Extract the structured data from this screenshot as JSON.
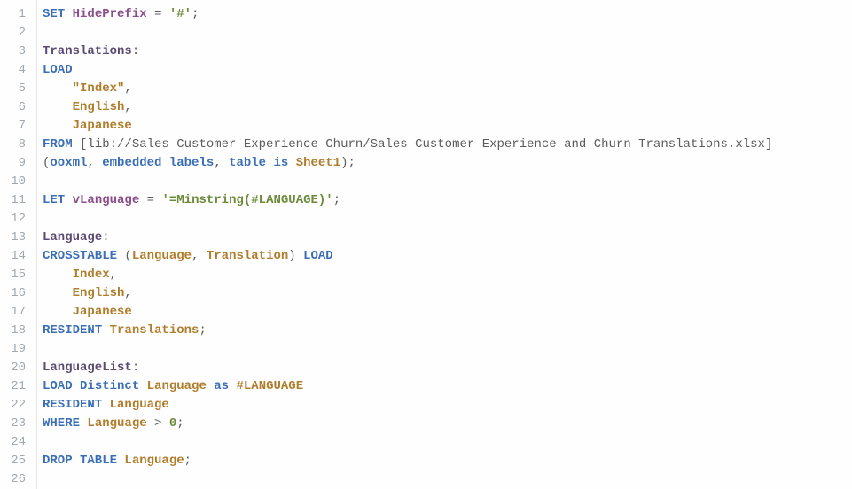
{
  "editor": {
    "lines": [
      {
        "tokens": [
          {
            "t": "SET",
            "c": "tok-set"
          },
          {
            "t": " ",
            "c": ""
          },
          {
            "t": "HidePrefix",
            "c": "tok-var"
          },
          {
            "t": " ",
            "c": ""
          },
          {
            "t": "=",
            "c": "tok-op"
          },
          {
            "t": " ",
            "c": ""
          },
          {
            "t": "'#'",
            "c": "tok-str"
          },
          {
            "t": ";",
            "c": "tok-punc"
          }
        ]
      },
      {
        "tokens": []
      },
      {
        "tokens": [
          {
            "t": "Translations",
            "c": "tok-label"
          },
          {
            "t": ":",
            "c": "tok-punc"
          }
        ]
      },
      {
        "tokens": [
          {
            "t": "LOAD",
            "c": "tok-kw"
          }
        ]
      },
      {
        "tokens": [
          {
            "t": "    ",
            "c": ""
          },
          {
            "t": "\"Index\"",
            "c": "tok-id"
          },
          {
            "t": ",",
            "c": "tok-punc"
          }
        ]
      },
      {
        "tokens": [
          {
            "t": "    ",
            "c": ""
          },
          {
            "t": "English",
            "c": "tok-id"
          },
          {
            "t": ",",
            "c": "tok-punc"
          }
        ]
      },
      {
        "tokens": [
          {
            "t": "    ",
            "c": ""
          },
          {
            "t": "Japanese",
            "c": "tok-id"
          }
        ]
      },
      {
        "tokens": [
          {
            "t": "FROM",
            "c": "tok-kw"
          },
          {
            "t": " ",
            "c": ""
          },
          {
            "t": "[lib://Sales Customer Experience Churn/Sales Customer Experience and Churn Translations.xlsx]",
            "c": "tok-path"
          }
        ]
      },
      {
        "tokens": [
          {
            "t": "(",
            "c": "tok-punc"
          },
          {
            "t": "ooxml",
            "c": "tok-kw"
          },
          {
            "t": ", ",
            "c": "tok-punc"
          },
          {
            "t": "embedded labels",
            "c": "tok-kw"
          },
          {
            "t": ", ",
            "c": "tok-punc"
          },
          {
            "t": "table is",
            "c": "tok-kw"
          },
          {
            "t": " ",
            "c": ""
          },
          {
            "t": "Sheet1",
            "c": "tok-id"
          },
          {
            "t": ");",
            "c": "tok-punc"
          }
        ]
      },
      {
        "tokens": []
      },
      {
        "tokens": [
          {
            "t": "LET",
            "c": "tok-set"
          },
          {
            "t": " ",
            "c": ""
          },
          {
            "t": "vLanguage",
            "c": "tok-var"
          },
          {
            "t": " ",
            "c": ""
          },
          {
            "t": "=",
            "c": "tok-op"
          },
          {
            "t": " ",
            "c": ""
          },
          {
            "t": "'=Minstring(#LANGUAGE)'",
            "c": "tok-str"
          },
          {
            "t": ";",
            "c": "tok-punc"
          }
        ]
      },
      {
        "tokens": []
      },
      {
        "tokens": [
          {
            "t": "Language",
            "c": "tok-label"
          },
          {
            "t": ":",
            "c": "tok-punc"
          }
        ]
      },
      {
        "tokens": [
          {
            "t": "CROSSTABLE",
            "c": "tok-kw"
          },
          {
            "t": " (",
            "c": "tok-punc"
          },
          {
            "t": "Language",
            "c": "tok-id"
          },
          {
            "t": ", ",
            "c": "tok-punc"
          },
          {
            "t": "Translation",
            "c": "tok-id"
          },
          {
            "t": ") ",
            "c": "tok-punc"
          },
          {
            "t": "LOAD",
            "c": "tok-kw"
          }
        ]
      },
      {
        "tokens": [
          {
            "t": "    ",
            "c": ""
          },
          {
            "t": "Index",
            "c": "tok-id"
          },
          {
            "t": ",",
            "c": "tok-punc"
          }
        ]
      },
      {
        "tokens": [
          {
            "t": "    ",
            "c": ""
          },
          {
            "t": "English",
            "c": "tok-id"
          },
          {
            "t": ",",
            "c": "tok-punc"
          }
        ]
      },
      {
        "tokens": [
          {
            "t": "    ",
            "c": ""
          },
          {
            "t": "Japanese",
            "c": "tok-id"
          }
        ]
      },
      {
        "tokens": [
          {
            "t": "RESIDENT",
            "c": "tok-kw"
          },
          {
            "t": " ",
            "c": ""
          },
          {
            "t": "Translations",
            "c": "tok-id"
          },
          {
            "t": ";",
            "c": "tok-punc"
          }
        ]
      },
      {
        "tokens": []
      },
      {
        "tokens": [
          {
            "t": "LanguageList",
            "c": "tok-label"
          },
          {
            "t": ":",
            "c": "tok-punc"
          }
        ]
      },
      {
        "tokens": [
          {
            "t": "LOAD",
            "c": "tok-kw"
          },
          {
            "t": " ",
            "c": ""
          },
          {
            "t": "Distinct",
            "c": "tok-kw"
          },
          {
            "t": " ",
            "c": ""
          },
          {
            "t": "Language",
            "c": "tok-id"
          },
          {
            "t": " ",
            "c": ""
          },
          {
            "t": "as",
            "c": "tok-kw"
          },
          {
            "t": " ",
            "c": ""
          },
          {
            "t": "#LANGUAGE",
            "c": "tok-id"
          }
        ]
      },
      {
        "tokens": [
          {
            "t": "RESIDENT",
            "c": "tok-kw"
          },
          {
            "t": " ",
            "c": ""
          },
          {
            "t": "Language",
            "c": "tok-id"
          }
        ]
      },
      {
        "tokens": [
          {
            "t": "WHERE",
            "c": "tok-kw"
          },
          {
            "t": " ",
            "c": ""
          },
          {
            "t": "Language",
            "c": "tok-id"
          },
          {
            "t": " ",
            "c": ""
          },
          {
            "t": ">",
            "c": "tok-op"
          },
          {
            "t": " ",
            "c": ""
          },
          {
            "t": "0",
            "c": "tok-num"
          },
          {
            "t": ";",
            "c": "tok-punc"
          }
        ]
      },
      {
        "tokens": []
      },
      {
        "tokens": [
          {
            "t": "DROP TABLE",
            "c": "tok-kw"
          },
          {
            "t": " ",
            "c": ""
          },
          {
            "t": "Language",
            "c": "tok-id"
          },
          {
            "t": ";",
            "c": "tok-punc"
          }
        ]
      },
      {
        "tokens": []
      }
    ],
    "line_count": 26,
    "cursor_line": 10
  }
}
